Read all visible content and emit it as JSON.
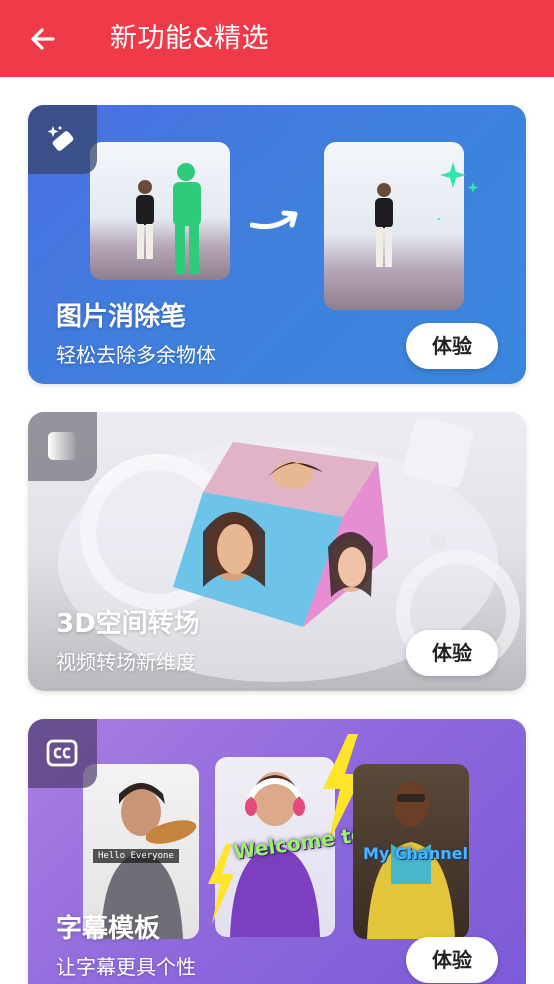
{
  "header": {
    "title": "新功能&精选",
    "background_color": "#ef3a4a"
  },
  "cards": [
    {
      "title": "图片消除笔",
      "subtitle": "轻松去除多余物体",
      "button_label": "体验",
      "badge_icon": "eraser-sparkle-icon"
    },
    {
      "title": "3D空间转场",
      "subtitle": "视频转场新维度",
      "button_label": "体验",
      "badge_icon": "gradient-square-icon"
    },
    {
      "title": "字幕模板",
      "subtitle": "让字幕更具个性",
      "button_label": "体验",
      "badge_icon": "cc-caption-icon",
      "caption_samples": [
        "Hello Everyone",
        "Welcome to",
        "My Channel"
      ]
    }
  ]
}
